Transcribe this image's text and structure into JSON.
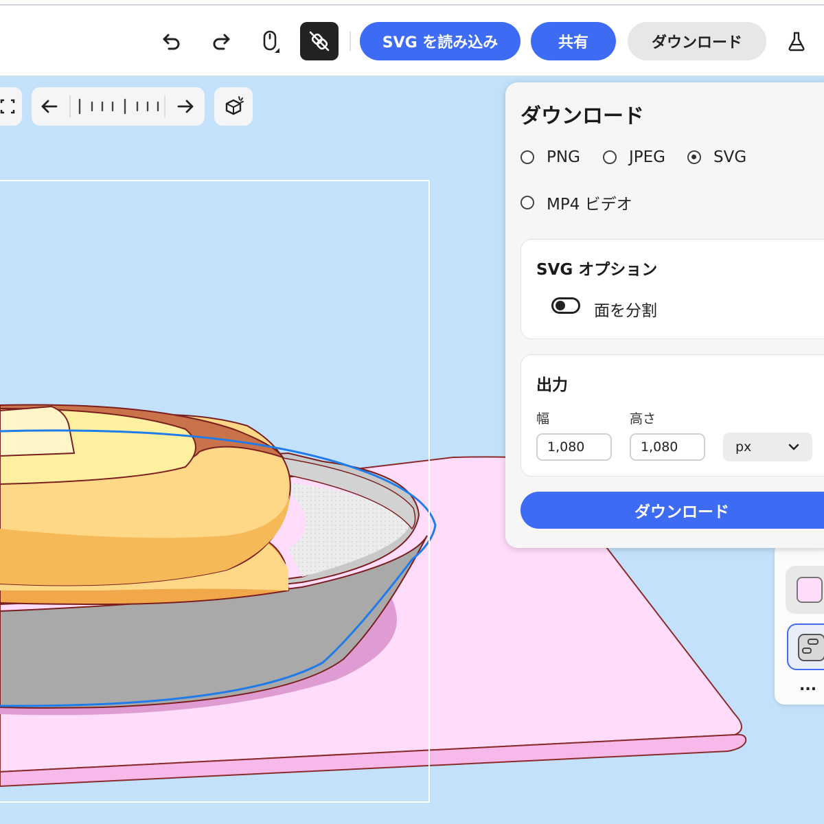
{
  "toolbar": {
    "undo_icon": "undo-icon",
    "redo_icon": "redo-icon",
    "mouse_icon": "mouse-icon",
    "link_icon": "unlink-icon",
    "import_label": "SVG を読み込み",
    "share_label": "共有",
    "download_label": "ダウンロード",
    "lab_icon": "flask-icon"
  },
  "canvas_tools": {
    "fit_icon": "frame-icon",
    "prev_icon": "arrow-left-icon",
    "next_icon": "arrow-right-icon",
    "light_icon": "light-cube-icon"
  },
  "download_panel": {
    "title": "ダウンロード",
    "formats": [
      {
        "label": "PNG",
        "selected": false
      },
      {
        "label": "JPEG",
        "selected": false
      },
      {
        "label": "SVG",
        "selected": true
      },
      {
        "label": "MP4 ビデオ",
        "selected": false
      }
    ],
    "svg_options": {
      "title": "SVG オプション",
      "split_faces_label": "面を分割",
      "split_faces_on": false
    },
    "output": {
      "title": "出力",
      "width_label": "幅",
      "width_value": "1,080",
      "height_label": "高さ",
      "height_value": "1,080",
      "unit": "px"
    },
    "download_button": "ダウンロード"
  },
  "colors": {
    "accent": "#3d6bf4",
    "canvas_bg": "#c4e1fb",
    "plate": "#ffdcf9",
    "pancake": "#ffd887",
    "pan": "#c8c8c8"
  },
  "swatches": {
    "more_label": "..."
  }
}
